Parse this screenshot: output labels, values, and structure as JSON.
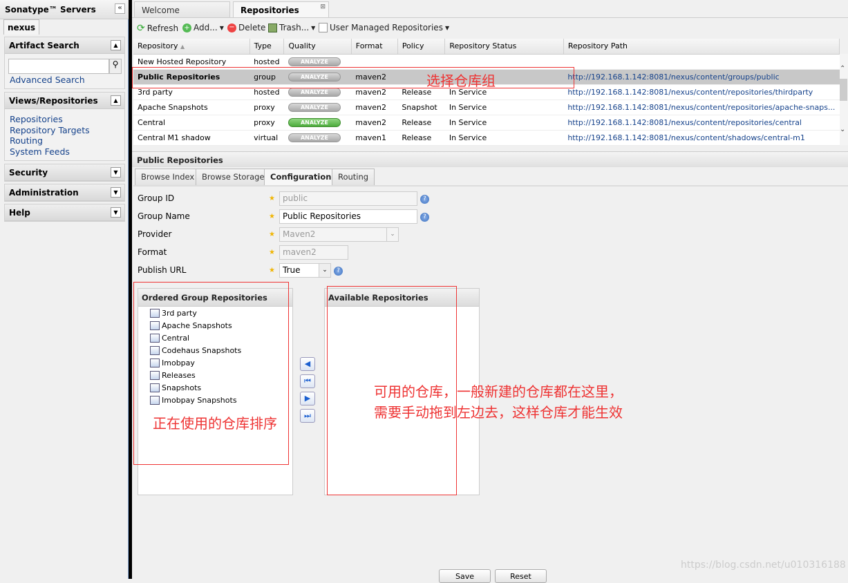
{
  "sidebar": {
    "title": "Sonatype™ Servers",
    "server_tab": "nexus",
    "artifact_search": {
      "title": "Artifact Search",
      "advanced": "Advanced Search",
      "placeholder": ""
    },
    "views": {
      "title": "Views/Repositories",
      "items": [
        "Repositories",
        "Repository Targets",
        "Routing",
        "System Feeds"
      ]
    },
    "sections": [
      "Security",
      "Administration",
      "Help"
    ]
  },
  "tabs": [
    "Welcome",
    "Repositories"
  ],
  "toolbar": {
    "refresh": "Refresh",
    "add": "Add...",
    "delete": "Delete",
    "trash": "Trash...",
    "user_managed": "User Managed Repositories"
  },
  "grid": {
    "columns": [
      "Repository",
      "Type",
      "Quality",
      "Format",
      "Policy",
      "Repository Status",
      "Repository Path"
    ],
    "rows": [
      {
        "name": "New Hosted Repository",
        "type": "hosted",
        "quality": "ANALYZE",
        "format": "",
        "policy": "",
        "status": "",
        "path": ""
      },
      {
        "name": "Public Repositories",
        "type": "group",
        "quality": "ANALYZE",
        "format": "maven2",
        "policy": "",
        "status": "",
        "path": "http://192.168.1.142:8081/nexus/content/groups/public"
      },
      {
        "name": "3rd party",
        "type": "hosted",
        "quality": "ANALYZE",
        "format": "maven2",
        "policy": "Release",
        "status": "In Service",
        "path": "http://192.168.1.142:8081/nexus/content/repositories/thirdparty"
      },
      {
        "name": "Apache Snapshots",
        "type": "proxy",
        "quality": "ANALYZE",
        "format": "maven2",
        "policy": "Snapshot",
        "status": "In Service",
        "path": "http://192.168.1.142:8081/nexus/content/repositories/apache-snaps..."
      },
      {
        "name": "Central",
        "type": "proxy",
        "quality": "ANALYZE",
        "format": "maven2",
        "policy": "Release",
        "status": "In Service",
        "path": "http://192.168.1.142:8081/nexus/content/repositories/central"
      },
      {
        "name": "Central M1 shadow",
        "type": "virtual",
        "quality": "ANALYZE",
        "format": "maven1",
        "policy": "Release",
        "status": "In Service",
        "path": "http://192.168.1.142:8081/nexus/content/shadows/central-m1"
      }
    ]
  },
  "detail": {
    "title": "Public Repositories",
    "tabs": [
      "Browse Index",
      "Browse Storage",
      "Configuration",
      "Routing"
    ],
    "form": {
      "group_id_label": "Group ID",
      "group_id": "public",
      "group_name_label": "Group Name",
      "group_name": "Public Repositories",
      "provider_label": "Provider",
      "provider": "Maven2",
      "format_label": "Format",
      "format": "maven2",
      "publish_label": "Publish URL",
      "publish": "True"
    },
    "ordered_title": "Ordered Group Repositories",
    "ordered": [
      "3rd party",
      "Apache Snapshots",
      "Central",
      "Codehaus Snapshots",
      "Imobpay",
      "Releases",
      "Snapshots",
      "Imobpay Snapshots"
    ],
    "available_title": "Available Repositories",
    "save": "Save",
    "reset": "Reset"
  },
  "annotations": {
    "select": "选择仓库组",
    "using": "正在使用的仓库排序",
    "available1": "可用的仓库，一般新建的仓库都在这里，",
    "available2": "需要手动拖到左边去，这样仓库才能生效"
  },
  "watermark": "https://blog.csdn.net/u010316188"
}
